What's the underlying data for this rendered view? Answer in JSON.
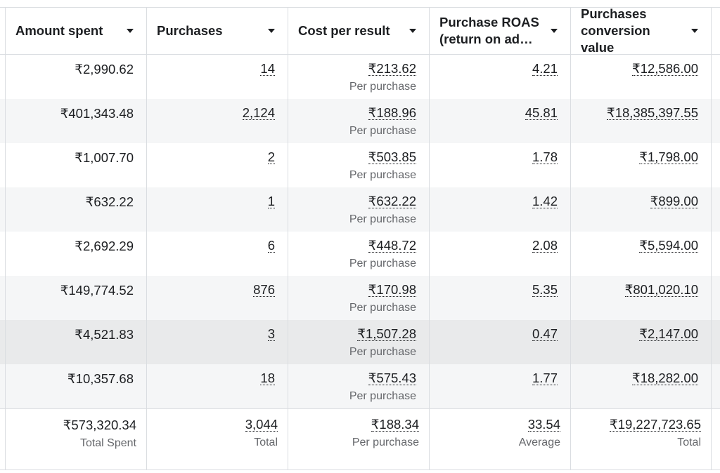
{
  "columns": [
    {
      "label": "Amount spent"
    },
    {
      "label": "Purchases"
    },
    {
      "label": "Cost per result"
    },
    {
      "label": "Purchase ROAS\n(return on ad…"
    },
    {
      "label": "Purchases\nconversion value"
    }
  ],
  "rows": [
    {
      "amount": "₹2,990.62",
      "purchases": "14",
      "cost": "₹213.62",
      "cost_sub": "Per purchase",
      "roas": "4.21",
      "value": "₹12,586.00"
    },
    {
      "amount": "₹401,343.48",
      "purchases": "2,124",
      "cost": "₹188.96",
      "cost_sub": "Per purchase",
      "roas": "45.81",
      "value": "₹18,385,397.55"
    },
    {
      "amount": "₹1,007.70",
      "purchases": "2",
      "cost": "₹503.85",
      "cost_sub": "Per purchase",
      "roas": "1.78",
      "value": "₹1,798.00"
    },
    {
      "amount": "₹632.22",
      "purchases": "1",
      "cost": "₹632.22",
      "cost_sub": "Per purchase",
      "roas": "1.42",
      "value": "₹899.00"
    },
    {
      "amount": "₹2,692.29",
      "purchases": "6",
      "cost": "₹448.72",
      "cost_sub": "Per purchase",
      "roas": "2.08",
      "value": "₹5,594.00"
    },
    {
      "amount": "₹149,774.52",
      "purchases": "876",
      "cost": "₹170.98",
      "cost_sub": "Per purchase",
      "roas": "5.35",
      "value": "₹801,020.10"
    },
    {
      "amount": "₹4,521.83",
      "purchases": "3",
      "cost": "₹1,507.28",
      "cost_sub": "Per purchase",
      "roas": "0.47",
      "value": "₹2,147.00"
    },
    {
      "amount": "₹10,357.68",
      "purchases": "18",
      "cost": "₹575.43",
      "cost_sub": "Per purchase",
      "roas": "1.77",
      "value": "₹18,282.00"
    }
  ],
  "totals": {
    "amount": "₹573,320.34",
    "amount_sub": "Total Spent",
    "purchases": "3,044",
    "purchases_sub": "Total",
    "cost": "₹188.34",
    "cost_sub": "Per purchase",
    "roas": "33.54",
    "roas_sub": "Average",
    "value": "₹19,227,723.65",
    "value_sub": "Total"
  }
}
